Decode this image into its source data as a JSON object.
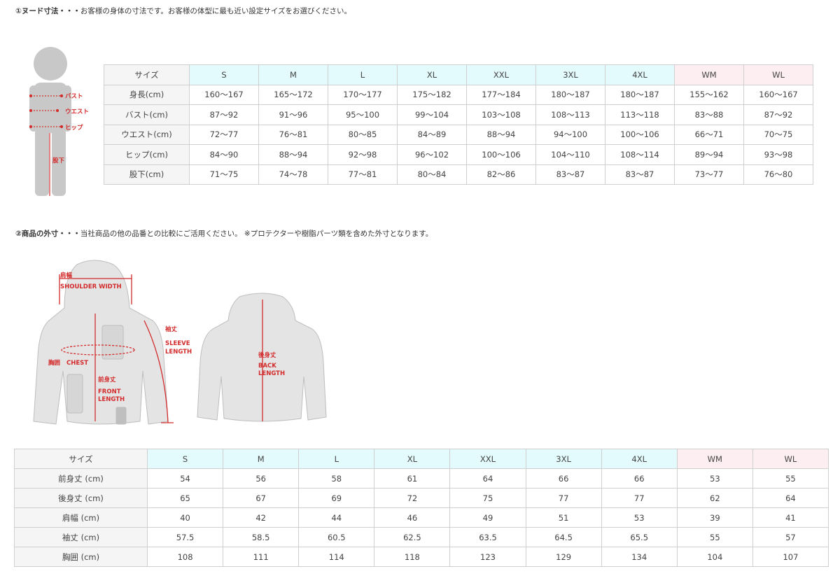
{
  "section1": {
    "title_bold": "①ヌード寸法・・・",
    "title_rest": "お客様の身体の寸法です。お客様の体型に最も近い設定サイズをお選びください。",
    "figure_labels": {
      "bust": "バスト",
      "waist": "ウエスト",
      "hip": "ヒップ",
      "inseam": "股下"
    },
    "table": {
      "header": [
        "サイズ",
        "S",
        "M",
        "L",
        "XL",
        "XXL",
        "3XL",
        "4XL",
        "WM",
        "WL"
      ],
      "rows": [
        [
          "身長(cm)",
          "160〜167",
          "165〜172",
          "170〜177",
          "175〜182",
          "177〜184",
          "180〜187",
          "180〜187",
          "155〜162",
          "160〜167"
        ],
        [
          "バスト(cm)",
          "87〜92",
          "91〜96",
          "95〜100",
          "99〜104",
          "103〜108",
          "108〜113",
          "113〜118",
          "83〜88",
          "87〜92"
        ],
        [
          "ウエスト(cm)",
          "72〜77",
          "76〜81",
          "80〜85",
          "84〜89",
          "88〜94",
          "94〜100",
          "100〜106",
          "66〜71",
          "70〜75"
        ],
        [
          "ヒップ(cm)",
          "84〜90",
          "88〜94",
          "92〜98",
          "96〜102",
          "100〜106",
          "104〜110",
          "108〜114",
          "89〜94",
          "93〜98"
        ],
        [
          "股下(cm)",
          "71〜75",
          "74〜78",
          "77〜81",
          "80〜84",
          "82〜86",
          "83〜87",
          "83〜87",
          "73〜77",
          "76〜80"
        ]
      ]
    }
  },
  "section2": {
    "title_bold": "②商品の外寸・・・",
    "title_rest": "当社商品の他の品番との比較にご活用ください。 ※プロテクターや樹脂パーツ類を含めた外寸となります。",
    "figure_labels": {
      "shoulder_jp": "肩幅",
      "shoulder_en": "SHOULDER WIDTH",
      "sleeve_jp": "袖丈",
      "sleeve_en1": "SLEEVE",
      "sleeve_en2": "LENGTH",
      "chest_jp": "胸囲",
      "chest_en": "CHEST",
      "front_jp": "前身丈",
      "front_en1": "FRONT",
      "front_en2": "LENGTH",
      "back_jp": "後身丈",
      "back_en1": "BACK",
      "back_en2": "LENGTH"
    },
    "table": {
      "header": [
        "サイズ",
        "S",
        "M",
        "L",
        "XL",
        "XXL",
        "3XL",
        "4XL",
        "WM",
        "WL"
      ],
      "rows": [
        [
          "前身丈 (cm)",
          "54",
          "56",
          "58",
          "61",
          "64",
          "66",
          "66",
          "53",
          "55"
        ],
        [
          "後身丈 (cm)",
          "65",
          "67",
          "69",
          "72",
          "75",
          "77",
          "77",
          "62",
          "64"
        ],
        [
          "肩幅 (cm)",
          "40",
          "42",
          "44",
          "46",
          "49",
          "51",
          "53",
          "39",
          "41"
        ],
        [
          "袖丈 (cm)",
          "57.5",
          "58.5",
          "60.5",
          "62.5",
          "63.5",
          "64.5",
          "65.5",
          "55",
          "57"
        ],
        [
          "胸囲 (cm)",
          "108",
          "111",
          "114",
          "118",
          "123",
          "129",
          "134",
          "104",
          "107"
        ]
      ]
    }
  },
  "colors": {
    "men_header": "#e3fbfc",
    "women_header": "#fdeef1",
    "measure_red": "#d32b2b",
    "figure_gray": "#c8c8c8"
  }
}
